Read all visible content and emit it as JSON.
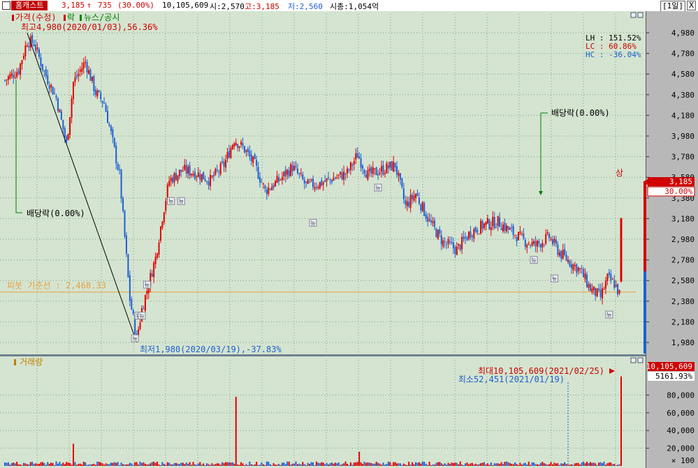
{
  "header": {
    "stock_name": "홈캐스트",
    "price": "3,185",
    "change_arrow": "↑",
    "change": "735",
    "change_pct": "(30.00%)",
    "volume": "10,105,609",
    "open": "시:2,570",
    "high": "고:3,185",
    "low": "저:2,560",
    "market_cap": "시총:1,054억",
    "period": "[1일]",
    "close_glyph": "X"
  },
  "price_panel": {
    "legend": {
      "price": "가격(수정)",
      "ex": "락",
      "news": "뉴스/공시"
    },
    "max_label": "최고4,980(2020/01/03),56.36%",
    "min_label": "최저1,980(2020/03/19),-37.83%",
    "stats": {
      "lh": "LH : 151.52%",
      "lc": "LC : 60.86%",
      "hc": "HC : -36.04%"
    },
    "pivot_label": "피봇 기준선 : 2,468.33",
    "dividend_label_left": "배당락(0.00%)",
    "dividend_label_right": "배당락(0.00%)",
    "limit_up_label": "상",
    "news_marker": "뉴",
    "current_price": "3,185",
    "current_pct": "30.00%",
    "y_ticks": [
      "4,980",
      "4,780",
      "4,580",
      "4,380",
      "4,180",
      "3,980",
      "3,780",
      "3,580",
      "3,380",
      "3,180",
      "2,980",
      "2,780",
      "2,580",
      "2,380",
      "2,180",
      "1,980"
    ]
  },
  "volume_panel": {
    "legend": "거래량",
    "max_label": "최대10,105,609(2021/02/25)",
    "min_label": "최소52,451(2021/01/19)",
    "max_value": "10,105,609",
    "max_pct": "5161.93%",
    "y_ticks": [
      "80,000",
      "60,000",
      "40,000",
      "20,000"
    ],
    "unit": "× 100"
  },
  "colors": {
    "up": "#e00000",
    "down": "#1f5fd0",
    "pivot": "#e8a040",
    "bg": "#d4e4d0",
    "axis_bg": "#b8b8b8",
    "green": "#008000"
  },
  "chart_data": {
    "type": "candlestick",
    "period": "1일",
    "price_ylim": [
      1980,
      4980
    ],
    "volume_ylim_x100": [
      0,
      100000
    ],
    "pivot": 2468.33,
    "max": {
      "value": 4980,
      "date": "2020/01/03",
      "pct": 56.36
    },
    "min": {
      "value": 1980,
      "date": "2020/03/19",
      "pct": -37.83
    },
    "volume_max": {
      "value": 10105609,
      "date": "2021/02/25"
    },
    "volume_min": {
      "value": 52451,
      "date": "2021/01/19"
    },
    "last": {
      "price": 3185,
      "change": 735,
      "change_pct": 30.0,
      "open": 2570,
      "high": 3185,
      "low": 2560,
      "volume": 10105609
    },
    "close_path": [
      {
        "i": 0,
        "p": 4520
      },
      {
        "i": 8,
        "p": 4620
      },
      {
        "i": 13,
        "p": 4900
      },
      {
        "i": 17,
        "p": 4880
      },
      {
        "i": 23,
        "p": 4600
      },
      {
        "i": 30,
        "p": 4350
      },
      {
        "i": 36,
        "p": 3900
      },
      {
        "i": 40,
        "p": 4500
      },
      {
        "i": 47,
        "p": 4700
      },
      {
        "i": 53,
        "p": 4400
      },
      {
        "i": 58,
        "p": 4300
      },
      {
        "i": 62,
        "p": 4000
      },
      {
        "i": 67,
        "p": 3600
      },
      {
        "i": 70,
        "p": 3000
      },
      {
        "i": 73,
        "p": 2400
      },
      {
        "i": 77,
        "p": 2020
      },
      {
        "i": 80,
        "p": 2300
      },
      {
        "i": 84,
        "p": 2550
      },
      {
        "i": 88,
        "p": 2800
      },
      {
        "i": 92,
        "p": 3200
      },
      {
        "i": 96,
        "p": 3550
      },
      {
        "i": 104,
        "p": 3650
      },
      {
        "i": 112,
        "p": 3620
      },
      {
        "i": 120,
        "p": 3550
      },
      {
        "i": 128,
        "p": 3700
      },
      {
        "i": 134,
        "p": 3950
      },
      {
        "i": 140,
        "p": 3850
      },
      {
        "i": 146,
        "p": 3700
      },
      {
        "i": 152,
        "p": 3450
      },
      {
        "i": 160,
        "p": 3550
      },
      {
        "i": 168,
        "p": 3680
      },
      {
        "i": 176,
        "p": 3500
      },
      {
        "i": 184,
        "p": 3520
      },
      {
        "i": 192,
        "p": 3570
      },
      {
        "i": 200,
        "p": 3620
      },
      {
        "i": 206,
        "p": 3800
      },
      {
        "i": 212,
        "p": 3600
      },
      {
        "i": 220,
        "p": 3650
      },
      {
        "i": 228,
        "p": 3700
      },
      {
        "i": 234,
        "p": 3300
      },
      {
        "i": 240,
        "p": 3420
      },
      {
        "i": 248,
        "p": 3150
      },
      {
        "i": 256,
        "p": 2950
      },
      {
        "i": 264,
        "p": 2880
      },
      {
        "i": 272,
        "p": 3050
      },
      {
        "i": 280,
        "p": 3120
      },
      {
        "i": 288,
        "p": 3150
      },
      {
        "i": 296,
        "p": 3050
      },
      {
        "i": 304,
        "p": 2960
      },
      {
        "i": 310,
        "p": 2920
      },
      {
        "i": 318,
        "p": 3000
      },
      {
        "i": 324,
        "p": 2850
      },
      {
        "i": 330,
        "p": 2760
      },
      {
        "i": 336,
        "p": 2680
      },
      {
        "i": 342,
        "p": 2500
      },
      {
        "i": 348,
        "p": 2420
      },
      {
        "i": 352,
        "p": 2600
      },
      {
        "i": 356,
        "p": 2550
      },
      {
        "i": 359,
        "p": 2450
      }
    ],
    "last_candle": {
      "i": 360,
      "open": 2570,
      "close": 3185,
      "high": 3185,
      "low": 2560
    },
    "volume_spikes_x100": [
      {
        "i": 40,
        "v": 25000
      },
      {
        "i": 135,
        "v": 78000
      },
      {
        "i": 207,
        "v": 16000
      },
      {
        "i": 360,
        "v": 101056
      }
    ]
  }
}
